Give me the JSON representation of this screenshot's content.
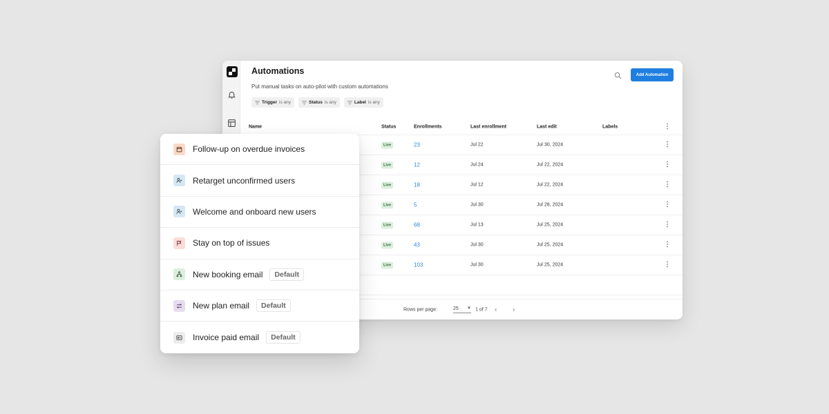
{
  "app": {
    "title": "Automations",
    "subtitle": "Put manual tasks on auto-pilot with custom automations",
    "add_button": "Add Automation",
    "filters": [
      {
        "label": "Trigger",
        "value": "is any"
      },
      {
        "label": "Status",
        "value": "is any"
      },
      {
        "label": "Label",
        "value": "is any"
      }
    ],
    "rail_icons": [
      "logo",
      "bell-icon",
      "layout-icon"
    ]
  },
  "table": {
    "columns": [
      "Name",
      "Status",
      "Enrollments",
      "Last enrollment",
      "Last edit",
      "Labels"
    ],
    "rows": [
      {
        "status": "Live",
        "enrollments": "23",
        "last_enrollment": "Jul 22",
        "last_edit": "Jul 30, 2024"
      },
      {
        "status": "Live",
        "enrollments": "12",
        "last_enrollment": "Jul 24",
        "last_edit": "Jul 22, 2024"
      },
      {
        "status": "Live",
        "enrollments": "18",
        "last_enrollment": "Jul 12",
        "last_edit": "Jul 22, 2024"
      },
      {
        "status": "Live",
        "enrollments": "5",
        "last_enrollment": "Jul 30",
        "last_edit": "Jul 28, 2024"
      },
      {
        "status": "Live",
        "enrollments": "68",
        "last_enrollment": "Jul 13",
        "last_edit": "Jul 25, 2024"
      },
      {
        "status": "Live",
        "enrollments": "43",
        "last_enrollment": "Jul 30",
        "last_edit": "Jul 25, 2024"
      },
      {
        "status": "Live",
        "enrollments": "103",
        "last_enrollment": "Jul 30",
        "last_edit": "Jul 25, 2024"
      }
    ]
  },
  "pager": {
    "rows_per_page_label": "Rows per page:",
    "rows_per_page": "25",
    "page_info": "1 of 7"
  },
  "automations_list": [
    {
      "name": "Follow-up on overdue invoices",
      "icon": "calendar-icon",
      "icon_bg": "#fbd9c6",
      "icon_color": "#5a3a2a",
      "badge": null
    },
    {
      "name": "Retarget unconfirmed users",
      "icon": "user-add-icon",
      "icon_bg": "#d6e7f3",
      "icon_color": "#3a4a5a",
      "badge": null
    },
    {
      "name": "Welcome and onboard new users",
      "icon": "user-add-icon",
      "icon_bg": "#d6e7f3",
      "icon_color": "#3a4a5a",
      "badge": null
    },
    {
      "name": "Stay on top of issues",
      "icon": "flag-icon",
      "icon_bg": "#fcdcd8",
      "icon_color": "#6a2a2a",
      "badge": null
    },
    {
      "name": "New booking email",
      "icon": "hierarchy-icon",
      "icon_bg": "#dcefdc",
      "icon_color": "#2a4a2a",
      "badge": "Default"
    },
    {
      "name": "New plan email",
      "icon": "swap-icon",
      "icon_bg": "#e7dcef",
      "icon_color": "#4a2a5a",
      "badge": "Default"
    },
    {
      "name": "Invoice paid email",
      "icon": "receipt-icon",
      "icon_bg": "#ececec",
      "icon_color": "#444444",
      "badge": "Default"
    }
  ]
}
